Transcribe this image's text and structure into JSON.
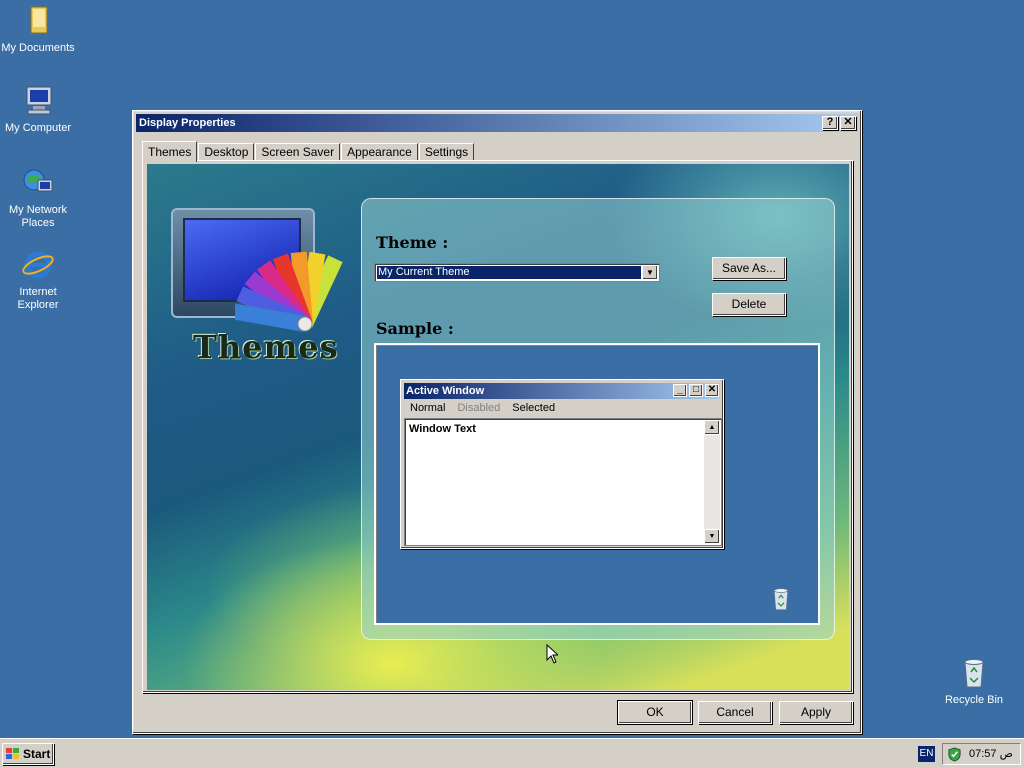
{
  "desktop": {
    "icons": [
      {
        "label": "My Documents"
      },
      {
        "label": "My Computer"
      },
      {
        "label": "My Network Places"
      },
      {
        "label": "Internet Explorer"
      },
      {
        "label": "Recycle Bin"
      }
    ]
  },
  "window": {
    "title": "Display Properties",
    "help_btn": "?",
    "close_btn": "✕",
    "tabs": [
      "Themes",
      "Desktop",
      "Screen Saver",
      "Appearance",
      "Settings"
    ],
    "active_tab": "Themes",
    "logo_text": "Themes",
    "theme_heading": "Theme :",
    "theme_value": "My Current Theme",
    "save_as": "Save As...",
    "delete": "Delete",
    "sample_heading": "Sample :",
    "sample": {
      "title": "Active Window",
      "menu": [
        "Normal",
        "Disabled",
        "Selected"
      ],
      "text": "Window Text"
    },
    "ok": "OK",
    "cancel": "Cancel",
    "apply": "Apply"
  },
  "taskbar": {
    "start": "Start",
    "lang": "EN",
    "clock": "07:57 ص"
  },
  "colors": {
    "desktop": "#3a6ea5",
    "titlebar_start": "#0a246a",
    "titlebar_end": "#a6caf0",
    "face": "#d4d0c8"
  },
  "icons": [
    "folder-icon",
    "computer-icon",
    "network-icon",
    "ie-icon",
    "recycle-bin-icon",
    "windows-flag-icon",
    "shield-icon"
  ]
}
